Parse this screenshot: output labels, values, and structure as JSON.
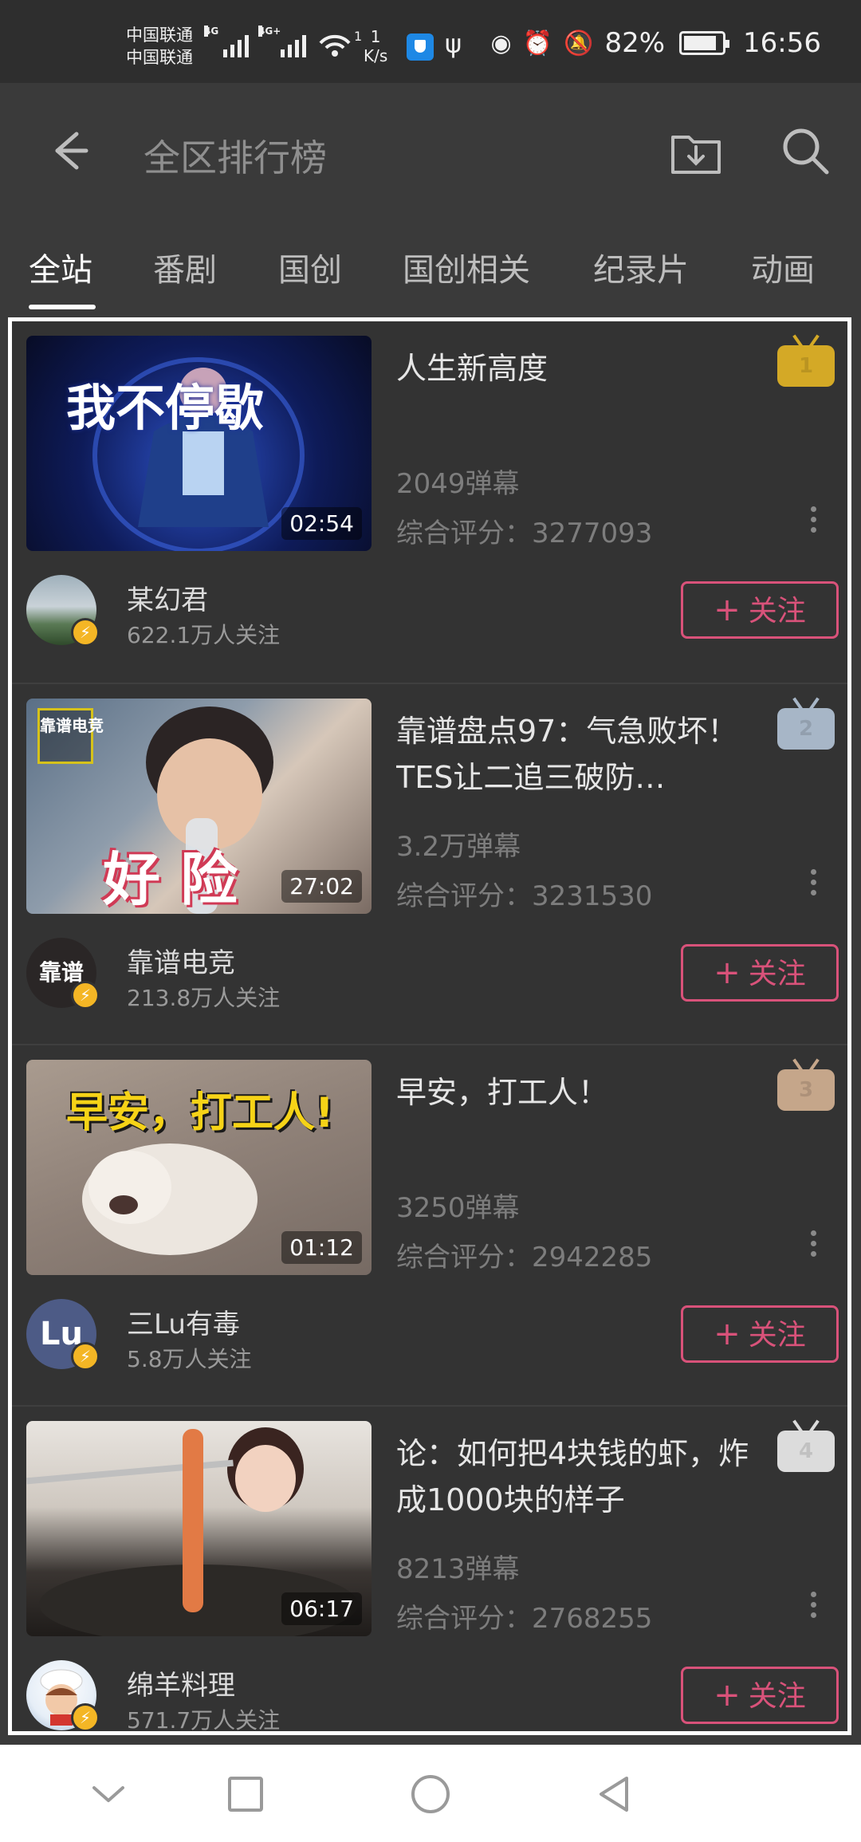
{
  "status": {
    "carrier1": "中国联通",
    "carrier2": "中国联通",
    "sim1_tag": "4G",
    "sim2_tag": "4G+",
    "wifi_sup": "1",
    "speed_value": "1",
    "speed_unit": "K/s",
    "battery": "82%",
    "time": "16:56"
  },
  "header": {
    "title": "全区排行榜"
  },
  "tabs": [
    "全站",
    "番剧",
    "国创",
    "国创相关",
    "纪录片",
    "动画"
  ],
  "items": [
    {
      "rank": "1",
      "rank_color": "#d4a926",
      "title": "人生新高度",
      "thumb_text": "我不停歇",
      "duration": "02:54",
      "danmaku": "2049弹幕",
      "score_label": "综合评分：",
      "score": "3277093",
      "uploader": "某幻君",
      "followers": "622.1万人关注",
      "follow_label": "关注"
    },
    {
      "rank": "2",
      "rank_color": "#a7b6c7",
      "title": "靠谱盘点97：气急败坏！TES让二追三破防…",
      "thumb_text": "好 险",
      "thumb_logo": "靠谱电竞",
      "duration": "27:02",
      "danmaku": "3.2万弹幕",
      "score_label": "综合评分：",
      "score": "3231530",
      "uploader": "靠谱电竞",
      "avatar_text": "靠谱",
      "followers": "213.8万人关注",
      "follow_label": "关注"
    },
    {
      "rank": "3",
      "rank_color": "#c5a68a",
      "title": "早安，打工人！",
      "thumb_text": "早安，打工人!",
      "duration": "01:12",
      "danmaku": "3250弹幕",
      "score_label": "综合评分：",
      "score": "2942285",
      "uploader": "三Lu有毒",
      "avatar_text": "Lu",
      "followers": "5.8万人关注",
      "follow_label": "关注"
    },
    {
      "rank": "4",
      "rank_color": "#dcdcdc",
      "title": "论：如何把4块钱的虾，炸成1000块的样子",
      "duration": "06:17",
      "danmaku": "8213弹幕",
      "score_label": "综合评分：",
      "score": "2768255",
      "uploader": "绵羊料理",
      "followers": "571.7万人关注",
      "follow_label": "关注"
    }
  ],
  "icons": {
    "back": "arrow-left-icon",
    "download": "download-folder-icon",
    "search": "search-icon",
    "more": "more-vertical-icon",
    "nav_hide": "chevron-down-icon",
    "nav_recent": "square-icon",
    "nav_home": "circle-icon",
    "nav_back": "triangle-back-icon"
  },
  "colors": {
    "accent": "#d9527a",
    "background": "#3a3a3a",
    "verified": "#f4b625"
  }
}
